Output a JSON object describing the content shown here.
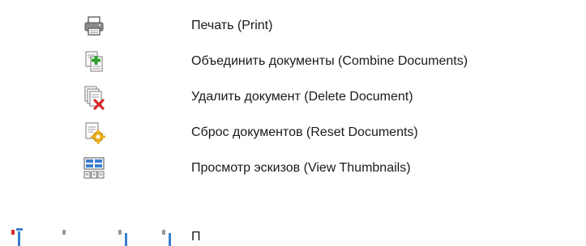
{
  "items": [
    {
      "icon": "printer-icon",
      "label": "Печать (Print)"
    },
    {
      "icon": "combine-documents-icon",
      "label": "Объединить документы (Combine Documents)"
    },
    {
      "icon": "delete-document-icon",
      "label": "Удалить документ (Delete Document)"
    },
    {
      "icon": "reset-documents-icon",
      "label": "Сброс документов (Reset Documents)"
    },
    {
      "icon": "view-thumbnails-icon",
      "label": "Просмотр эскизов (View Thumbnails)"
    }
  ],
  "partial_row": {
    "label": "П"
  },
  "colors": {
    "text": "#1a1a1a",
    "icon_gray": "#6b6b6b",
    "add_green": "#2e9e2e",
    "delete_red": "#d62a2a",
    "gear_yellow": "#e8b21c",
    "blue_accent": "#3a7fd0"
  }
}
